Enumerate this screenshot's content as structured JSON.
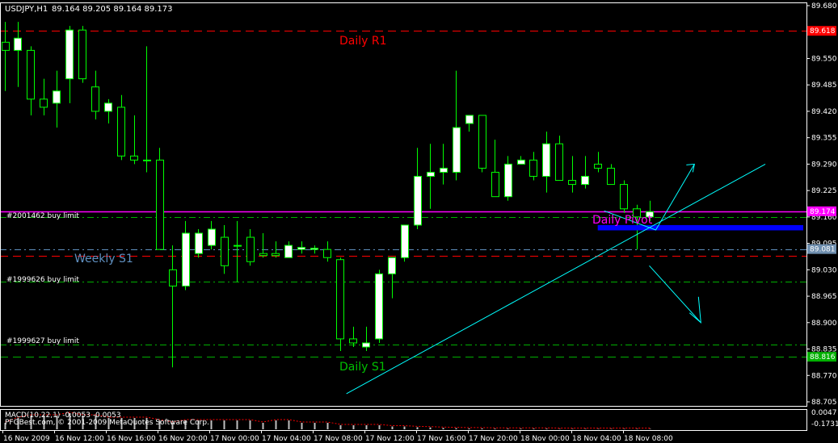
{
  "header": {
    "symbol": "USDJPY,H1",
    "ohlc": "89.164 89.205 89.164 89.173"
  },
  "chart_data": {
    "type": "candlestick",
    "symbol": "USDJPY",
    "timeframe": "H1",
    "ylim": [
      88.705,
      89.68
    ],
    "y_ticks": [
      "89.680",
      "89.615",
      "89.550",
      "89.485",
      "89.420",
      "89.355",
      "89.290",
      "89.225",
      "89.160",
      "89.095",
      "89.030",
      "88.965",
      "88.900",
      "88.835",
      "88.770",
      "88.705"
    ],
    "x_ticks": [
      "16 Nov 2009",
      "16 Nov 12:00",
      "16 Nov 16:00",
      "16 Nov 20:00",
      "17 Nov 00:00",
      "17 Nov 04:00",
      "17 Nov 08:00",
      "17 Nov 12:00",
      "17 Nov 16:00",
      "17 Nov 20:00",
      "18 Nov 00:00",
      "18 Nov 04:00",
      "18 Nov 08:00"
    ],
    "candles": [
      {
        "o": 89.59,
        "h": 89.64,
        "l": 89.47,
        "c": 89.57
      },
      {
        "o": 89.57,
        "h": 89.64,
        "l": 89.48,
        "c": 89.6
      },
      {
        "o": 89.57,
        "h": 89.58,
        "l": 89.41,
        "c": 89.45
      },
      {
        "o": 89.45,
        "h": 89.5,
        "l": 89.41,
        "c": 89.43
      },
      {
        "o": 89.44,
        "h": 89.52,
        "l": 89.38,
        "c": 89.47
      },
      {
        "o": 89.5,
        "h": 89.63,
        "l": 89.44,
        "c": 89.62
      },
      {
        "o": 89.62,
        "h": 89.63,
        "l": 89.49,
        "c": 89.5
      },
      {
        "o": 89.48,
        "h": 89.52,
        "l": 89.4,
        "c": 89.42
      },
      {
        "o": 89.42,
        "h": 89.45,
        "l": 89.39,
        "c": 89.44
      },
      {
        "o": 89.43,
        "h": 89.46,
        "l": 89.3,
        "c": 89.31
      },
      {
        "o": 89.31,
        "h": 89.41,
        "l": 89.29,
        "c": 89.3
      },
      {
        "o": 89.3,
        "h": 89.58,
        "l": 89.27,
        "c": 89.3
      },
      {
        "o": 89.3,
        "h": 89.33,
        "l": 89.08,
        "c": 89.08
      },
      {
        "o": 89.03,
        "h": 89.09,
        "l": 88.79,
        "c": 88.99
      },
      {
        "o": 88.99,
        "h": 89.15,
        "l": 88.98,
        "c": 89.12
      },
      {
        "o": 89.07,
        "h": 89.13,
        "l": 89.06,
        "c": 89.12
      },
      {
        "o": 89.09,
        "h": 89.15,
        "l": 89.08,
        "c": 89.13
      },
      {
        "o": 89.11,
        "h": 89.14,
        "l": 89.02,
        "c": 89.04
      },
      {
        "o": 89.09,
        "h": 89.15,
        "l": 89.0,
        "c": 89.09
      },
      {
        "o": 89.11,
        "h": 89.13,
        "l": 89.04,
        "c": 89.05
      },
      {
        "o": 89.07,
        "h": 89.12,
        "l": 89.06,
        "c": 89.065
      },
      {
        "o": 89.07,
        "h": 89.1,
        "l": 89.06,
        "c": 89.065
      },
      {
        "o": 89.06,
        "h": 89.1,
        "l": 89.06,
        "c": 89.09
      },
      {
        "o": 89.08,
        "h": 89.1,
        "l": 89.07,
        "c": 89.085
      },
      {
        "o": 89.08,
        "h": 89.09,
        "l": 89.07,
        "c": 89.083
      },
      {
        "o": 89.08,
        "h": 89.1,
        "l": 89.05,
        "c": 89.06
      },
      {
        "o": 89.055,
        "h": 89.06,
        "l": 88.83,
        "c": 88.86
      },
      {
        "o": 88.86,
        "h": 88.89,
        "l": 88.84,
        "c": 88.85
      },
      {
        "o": 88.84,
        "h": 88.89,
        "l": 88.83,
        "c": 88.85
      },
      {
        "o": 88.86,
        "h": 89.03,
        "l": 88.85,
        "c": 89.02
      },
      {
        "o": 89.02,
        "h": 89.06,
        "l": 88.96,
        "c": 89.06
      },
      {
        "o": 89.06,
        "h": 89.13,
        "l": 89.05,
        "c": 89.14
      },
      {
        "o": 89.14,
        "h": 89.33,
        "l": 89.13,
        "c": 89.26
      },
      {
        "o": 89.26,
        "h": 89.34,
        "l": 89.18,
        "c": 89.27
      },
      {
        "o": 89.27,
        "h": 89.34,
        "l": 89.24,
        "c": 89.28
      },
      {
        "o": 89.27,
        "h": 89.52,
        "l": 89.25,
        "c": 89.38
      },
      {
        "o": 89.39,
        "h": 89.41,
        "l": 89.37,
        "c": 89.41
      },
      {
        "o": 89.41,
        "h": 89.41,
        "l": 89.27,
        "c": 89.28
      },
      {
        "o": 89.27,
        "h": 89.35,
        "l": 89.21,
        "c": 89.21
      },
      {
        "o": 89.21,
        "h": 89.31,
        "l": 89.2,
        "c": 89.29
      },
      {
        "o": 89.29,
        "h": 89.31,
        "l": 89.29,
        "c": 89.3
      },
      {
        "o": 89.3,
        "h": 89.32,
        "l": 89.25,
        "c": 89.26
      },
      {
        "o": 89.26,
        "h": 89.37,
        "l": 89.22,
        "c": 89.34
      },
      {
        "o": 89.34,
        "h": 89.36,
        "l": 89.25,
        "c": 89.25
      },
      {
        "o": 89.25,
        "h": 89.31,
        "l": 89.22,
        "c": 89.24
      },
      {
        "o": 89.24,
        "h": 89.31,
        "l": 89.23,
        "c": 89.26
      },
      {
        "o": 89.29,
        "h": 89.32,
        "l": 89.27,
        "c": 89.28
      },
      {
        "o": 89.28,
        "h": 89.29,
        "l": 89.24,
        "c": 89.24
      },
      {
        "o": 89.24,
        "h": 89.25,
        "l": 89.17,
        "c": 89.18
      },
      {
        "o": 89.18,
        "h": 89.19,
        "l": 89.08,
        "c": 89.16
      },
      {
        "o": 89.16,
        "h": 89.2,
        "l": 89.15,
        "c": 89.173
      }
    ],
    "levels": [
      {
        "name": "Daily R1",
        "price": 89.618,
        "color": "#ff0000",
        "style": "dash",
        "tag": "89.618",
        "tag_bg": "#ff0000"
      },
      {
        "name": "Daily Pivot",
        "price": 89.174,
        "color": "#ff00ff",
        "style": "solid",
        "tag": "89.174",
        "tag_bg": "#ff00ff"
      },
      {
        "name": "#2001462 buy limit",
        "price": 89.16,
        "color": "#00b000",
        "style": "dashdot",
        "tag": "",
        "tag_bg": ""
      },
      {
        "name": "Weekly S1",
        "price": 89.081,
        "color": "#5f8fbf",
        "style": "dashdot",
        "tag": "89.081",
        "tag_bg": "#6f8faf"
      },
      {
        "name": "",
        "price": 89.064,
        "color": "#ff0000",
        "style": "dash",
        "tag": "",
        "tag_bg": ""
      },
      {
        "name": "#1999626 buy limit",
        "price": 89.0,
        "color": "#00b000",
        "style": "dashdot",
        "tag": "",
        "tag_bg": ""
      },
      {
        "name": "#1999627 buy limit",
        "price": 88.845,
        "color": "#00b000",
        "style": "dashdot",
        "tag": "",
        "tag_bg": ""
      },
      {
        "name": "Daily S1",
        "price": 88.816,
        "color": "#00b000",
        "style": "dash",
        "tag": "88.816",
        "tag_bg": "#00b000"
      }
    ],
    "level_labels": {
      "daily_r1": "Daily R1",
      "daily_pivot": "Daily Pivot",
      "weekly_s1": "Weekly S1",
      "daily_s1": "Daily S1",
      "buy_limit_1": "#2001462 buy limit",
      "buy_limit_2": "#1999626 buy limit",
      "buy_limit_3": "#1999627 buy limit"
    },
    "current_price": {
      "price": 89.173,
      "tag": "89.174"
    },
    "drawings": {
      "trendline": {
        "from": {
          "bar": 26.5,
          "price": 88.725
        },
        "to": {
          "bar": 59,
          "price": 89.29
        },
        "color": "#00ffff"
      },
      "pivot_vertex": {
        "bar": 50.5,
        "price": 89.128
      },
      "arrow_up": {
        "bar": 53.5,
        "price": 89.29
      },
      "arrow_down": {
        "from": {
          "bar": 50.0,
          "price": 89.04
        },
        "to": {
          "bar": 54.0,
          "price": 88.9
        }
      },
      "blue_zone": {
        "from_bar": 46.0,
        "to_bar": 62,
        "price_top": 89.14,
        "price_bottom": 89.127,
        "color": "#0000ff"
      }
    },
    "macd": {
      "label": "MACD(10,22,1) -0.0053 -0.0053",
      "ticks": [
        "0.0047",
        "-0.1731"
      ],
      "histogram": [
        0.02,
        0.04,
        0.05,
        0.05,
        0.05,
        0.06,
        0.05,
        0.05,
        0.04,
        0.04,
        0.04,
        0.04,
        0.03,
        0.02,
        0.03,
        0.03,
        0.03,
        0.03,
        0.03,
        0.03,
        0.02,
        0.03,
        0.03,
        0.02,
        0.02,
        0.02,
        0.01,
        0.01,
        0.01,
        0.01,
        0.005,
        0.005,
        0.002,
        0.001,
        -0.001,
        -0.002,
        -0.003,
        -0.003,
        -0.004,
        -0.004,
        -0.004,
        -0.004,
        -0.004,
        -0.005,
        -0.005,
        -0.005,
        -0.005,
        -0.005,
        -0.005,
        -0.005,
        -0.005
      ]
    }
  },
  "footer": {
    "copyright": "PFGBest.com, © 2001-2009 MetaQuotes Software Corp."
  },
  "colors": {
    "background": "#000000",
    "axis": "#ffffff",
    "bull_body": "#ffffff",
    "bear_body": "#000000",
    "wick": "#00ff00",
    "current_tag_bg": "#ff00ff"
  }
}
